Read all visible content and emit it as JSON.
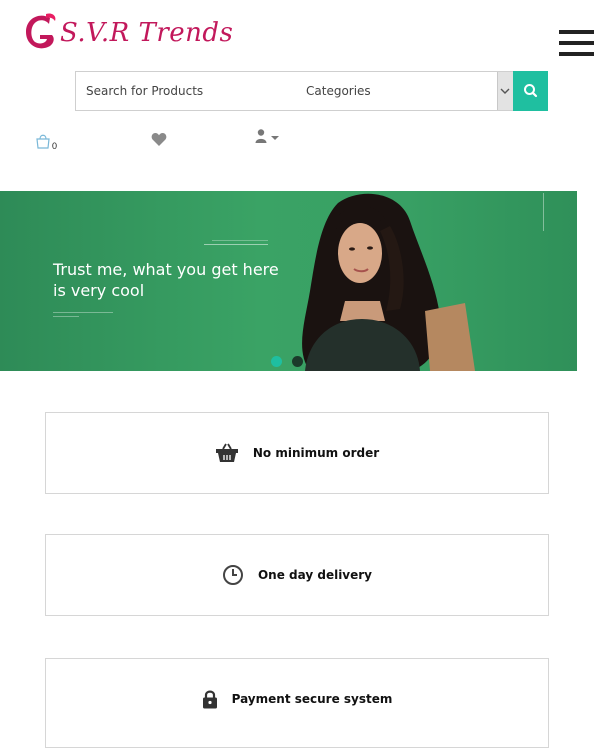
{
  "header": {
    "logo_text": "S.V.R Trends",
    "brand_color": "#c2185b",
    "menu_icon": "hamburger-menu-icon"
  },
  "search": {
    "placeholder": "Search for Products",
    "categories_label": "Categories",
    "button_icon": "search-icon",
    "accent_color": "#1fbfa0"
  },
  "toolbar": {
    "cart_count": "0",
    "cart_icon": "shopping-bag-icon",
    "wishlist_icon": "heart-icon",
    "account_icon": "user-icon"
  },
  "banner": {
    "headline": "Trust me, what you get here is very cool",
    "background_color": "#3aa365",
    "slide_count": 2,
    "active_slide": 1
  },
  "features": [
    {
      "label": "No minimum order",
      "icon": "basket-icon"
    },
    {
      "label": "One day delivery",
      "icon": "clock-icon"
    },
    {
      "label": "Payment secure system",
      "icon": "lock-icon"
    }
  ]
}
